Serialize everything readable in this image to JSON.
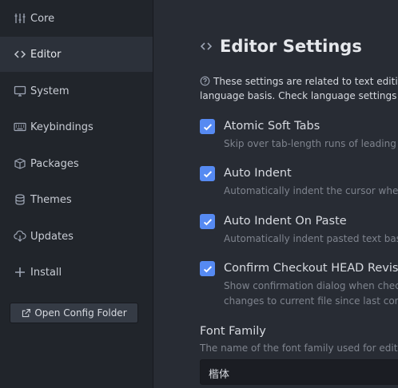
{
  "sidebar": {
    "items": [
      {
        "label": "Core",
        "icon": "sliders-icon"
      },
      {
        "label": "Editor",
        "icon": "code-icon"
      },
      {
        "label": "System",
        "icon": "monitor-icon"
      },
      {
        "label": "Keybindings",
        "icon": "keyboard-icon"
      },
      {
        "label": "Packages",
        "icon": "package-icon"
      },
      {
        "label": "Themes",
        "icon": "paintcan-icon"
      },
      {
        "label": "Updates",
        "icon": "cloud-download-icon"
      },
      {
        "label": "Install",
        "icon": "plus-icon"
      }
    ],
    "active": "Editor",
    "open_config_label": "Open Config Folder"
  },
  "main": {
    "title": "Editor Settings",
    "description_line1": "These settings are related to text editing",
    "description_line2": "language basis. Check language settings by",
    "settings": [
      {
        "label": "Atomic Soft Tabs",
        "checked": true,
        "sub": [
          "Skip over tab-length runs of leading w"
        ]
      },
      {
        "label": "Auto Indent",
        "checked": true,
        "sub": [
          "Automatically indent the cursor when"
        ]
      },
      {
        "label": "Auto Indent On Paste",
        "checked": true,
        "sub": [
          "Automatically indent pasted text based"
        ]
      },
      {
        "label": "Confirm Checkout HEAD Revisio",
        "checked": true,
        "sub": [
          "Show confirmation dialog when check",
          "changes to current file since last comm"
        ]
      }
    ],
    "font_family": {
      "title": "Font Family",
      "description": "The name of the font family used for editor",
      "value": "楷体"
    }
  },
  "colors": {
    "accent": "#568af2",
    "sidebar_bg": "#21252b",
    "main_bg": "#282c34"
  }
}
